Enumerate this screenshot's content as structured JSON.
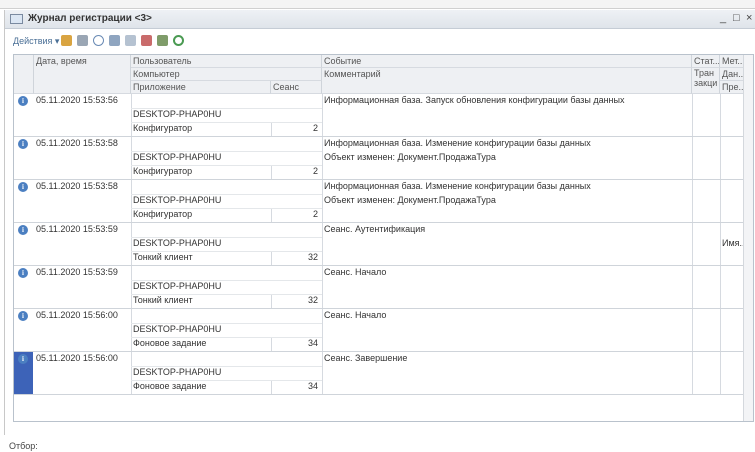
{
  "window": {
    "title": "Журнал регистрации <3>",
    "minimize": "_",
    "maximize": "□",
    "close": "×"
  },
  "toolbar": {
    "actions_label": "Действия ▾"
  },
  "columns": {
    "datetime": "Дата, время",
    "user": "Пользователь",
    "computer": "Компьютер",
    "application": "Приложение",
    "session": "Сеанс",
    "event": "Событие",
    "comment": "Комментарий",
    "status": "Стат...",
    "transaction": "Тран закци",
    "metadata": "Мет...",
    "data": "Дан...",
    "presentation": "Пре..."
  },
  "entries": [
    {
      "datetime": "05.11.2020 15:53:56",
      "user": "",
      "computer": "DESKTOP-PHAP0HU",
      "application": "Конфигуратор",
      "session": "2",
      "event": "Информационная база. Запуск обновления конфигурации базы данных",
      "comment": "",
      "metadata": ""
    },
    {
      "datetime": "05.11.2020 15:53:58",
      "user": "",
      "computer": "DESKTOP-PHAP0HU",
      "application": "Конфигуратор",
      "session": "2",
      "event": "Информационная база. Изменение конфигурации базы данных",
      "comment": "Объект изменен: Документ.ПродажаТура",
      "metadata": ""
    },
    {
      "datetime": "05.11.2020 15:53:58",
      "user": "",
      "computer": "DESKTOP-PHAP0HU",
      "application": "Конфигуратор",
      "session": "2",
      "event": "Информационная база. Изменение конфигурации базы данных",
      "comment": "Объект изменен: Документ.ПродажаТура",
      "metadata": ""
    },
    {
      "datetime": "05.11.2020 15:53:59",
      "user": "",
      "computer": "DESKTOP-PHAP0HU",
      "application": "Тонкий клиент",
      "session": "32",
      "event": "Сеанс. Аутентификация",
      "comment": "",
      "metadata": "Имя..."
    },
    {
      "datetime": "05.11.2020 15:53:59",
      "user": "",
      "computer": "DESKTOP-PHAP0HU",
      "application": "Тонкий клиент",
      "session": "32",
      "event": "Сеанс. Начало",
      "comment": "",
      "metadata": ""
    },
    {
      "datetime": "05.11.2020 15:56:00",
      "user": "",
      "computer": "DESKTOP-PHAP0HU",
      "application": "Фоновое задание",
      "session": "34",
      "event": "Сеанс. Начало",
      "comment": "",
      "metadata": ""
    },
    {
      "datetime": "05.11.2020 15:56:00",
      "user": "",
      "computer": "DESKTOP-PHAP0HU",
      "application": "Фоновое задание",
      "session": "34",
      "event": "Сеанс. Завершение",
      "comment": "",
      "metadata": ""
    }
  ],
  "selected_index": 6,
  "footer": {
    "filter_label": "Отбор:"
  },
  "colors": {
    "accent": "#3d63b8",
    "info_icon": "#4b7fc1",
    "link": "#4a6f96"
  }
}
